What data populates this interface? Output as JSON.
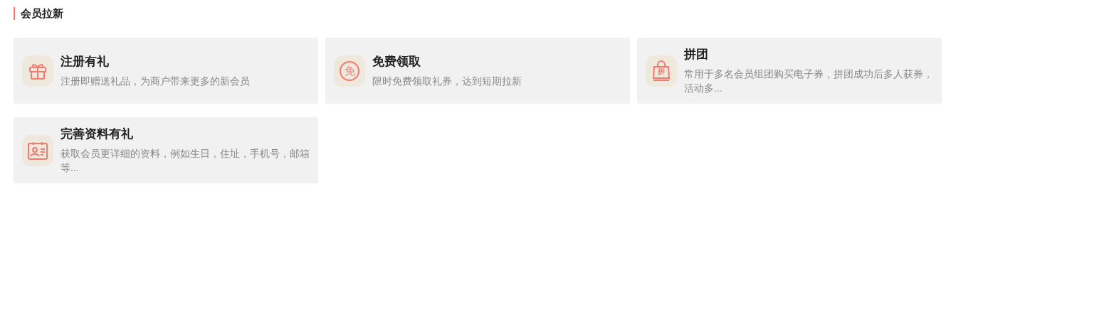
{
  "section": {
    "title": "会员拉新"
  },
  "cards": [
    {
      "kind": "gift",
      "title": "注册有礼",
      "description": "注册即赠送礼品，为商户带来更多的新会员"
    },
    {
      "kind": "circle_glyph",
      "glyph": "免",
      "title": "免费领取",
      "description": "限时免费领取礼券，达到短期拉新"
    },
    {
      "kind": "bag_glyph",
      "glyph": "拼",
      "title": "拼团",
      "description": "常用于多名会员组团购买电子券，拼团成功后多人获券，活动多..."
    },
    {
      "kind": "profile",
      "title": "完善资料有礼",
      "description": "获取会员更详细的资料，例如生日，住址，手机号，邮箱等..."
    }
  ]
}
